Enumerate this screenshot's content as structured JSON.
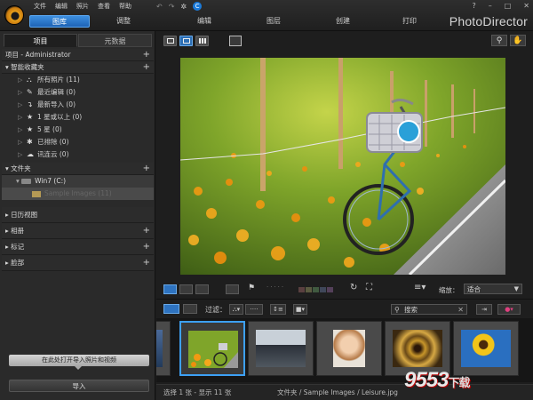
{
  "menu": [
    "文件",
    "编辑",
    "照片",
    "查看",
    "帮助"
  ],
  "mode_tabs": [
    "图库",
    "调整",
    "编辑",
    "图层",
    "创建",
    "打印"
  ],
  "active_mode": "图库",
  "brand": "PhotoDirector",
  "window_controls": [
    "?",
    "–",
    "□",
    "✕"
  ],
  "left_panel": {
    "tabs": [
      "项目",
      "元数据"
    ],
    "project_header": "项目 - Administrator",
    "smart_collections": {
      "label": "智能收藏夹",
      "items": [
        {
          "label": "所有照片 (11)",
          "icon": "people-icon"
        },
        {
          "label": "最近编辑 (0)",
          "icon": "edit-icon"
        },
        {
          "label": "最新导入 (0)",
          "icon": "import-icon"
        },
        {
          "label": "1 星或以上 (0)",
          "icon": "star-icon"
        },
        {
          "label": "5 星 (0)",
          "icon": "star-icon"
        },
        {
          "label": "已排除 (0)",
          "icon": "reject-icon"
        },
        {
          "label": "讯连云 (0)",
          "icon": "cloud-icon"
        }
      ]
    },
    "folders": {
      "label": "文件夹",
      "drive": "Win7 (C:)",
      "subfolder": "Sample Images (11)"
    },
    "calendar": "日历视图",
    "albums": "相册",
    "tags": "标记",
    "faces": "脸部",
    "import_hint": "在此处打开导入照片和视频",
    "import_button": "导入"
  },
  "toolbar": {
    "zoom_label": "缩放：",
    "zoom_value": "适合"
  },
  "filter": {
    "label": "过滤：",
    "search_placeholder": "搜索"
  },
  "status": {
    "selection": "选择 1 张 - 显示 11 张",
    "path": "文件夹 / Sample Images / Leisure.jpg"
  },
  "watermark": {
    "main": "9553",
    "sub": "下载"
  },
  "colors": {
    "accent": "#2e73c0",
    "selected_border": "#3da0f5",
    "logo": "#e8a21a"
  }
}
